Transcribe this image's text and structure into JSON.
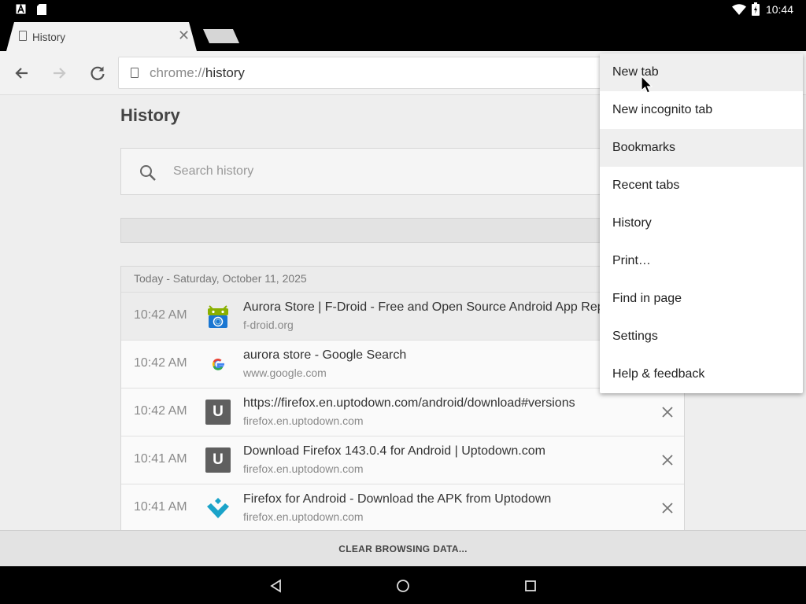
{
  "status_bar": {
    "time": "10:44",
    "left_icons": [
      "a-notification-icon",
      "sd-card-icon"
    ],
    "right_icons": [
      "wifi-icon",
      "battery-icon"
    ]
  },
  "tabs": [
    {
      "title": "History",
      "active": true
    }
  ],
  "toolbar": {
    "url_scheme": "chrome://",
    "url_host": "history",
    "icons": [
      "back-arrow-icon",
      "forward-arrow-icon",
      "reload-icon",
      "page-icon"
    ]
  },
  "page": {
    "title": "History",
    "search_placeholder": "Search history",
    "day_header": "Today - Saturday, October 11, 2025",
    "entries": [
      {
        "time": "10:42 AM",
        "title": "Aurora Store | F-Droid - Free and Open Source Android App Repo",
        "domain": "f-droid.org",
        "icon": "fdroid-icon"
      },
      {
        "time": "10:42 AM",
        "title": "aurora store - Google Search",
        "domain": "www.google.com",
        "icon": "google-icon"
      },
      {
        "time": "10:42 AM",
        "title": "https://firefox.en.uptodown.com/android/download#versions",
        "domain": "firefox.en.uptodown.com",
        "icon": "uptodown-letter-icon",
        "letter": "U"
      },
      {
        "time": "10:41 AM",
        "title": "Download Firefox 143.0.4 for Android | Uptodown.com",
        "domain": "firefox.en.uptodown.com",
        "icon": "uptodown-letter-icon",
        "letter": "U"
      },
      {
        "time": "10:41 AM",
        "title": "Firefox for Android - Download the APK from Uptodown",
        "domain": "firefox.en.uptodown.com",
        "icon": "uptodown-logo-icon"
      }
    ],
    "clear_button": "CLEAR BROWSING DATA..."
  },
  "menu": {
    "items": [
      "New tab",
      "New incognito tab",
      "Bookmarks",
      "Recent tabs",
      "History",
      "Print…",
      "Find in page",
      "Settings",
      "Help & feedback"
    ]
  },
  "colors": {
    "uptodown_blue": "#1aa3c9",
    "google_blue": "#4285f4",
    "google_red": "#ea4335",
    "google_yellow": "#fbbc05",
    "google_green": "#34a853",
    "fdroid_green": "#8ab000",
    "fdroid_blue": "#1976d2"
  }
}
